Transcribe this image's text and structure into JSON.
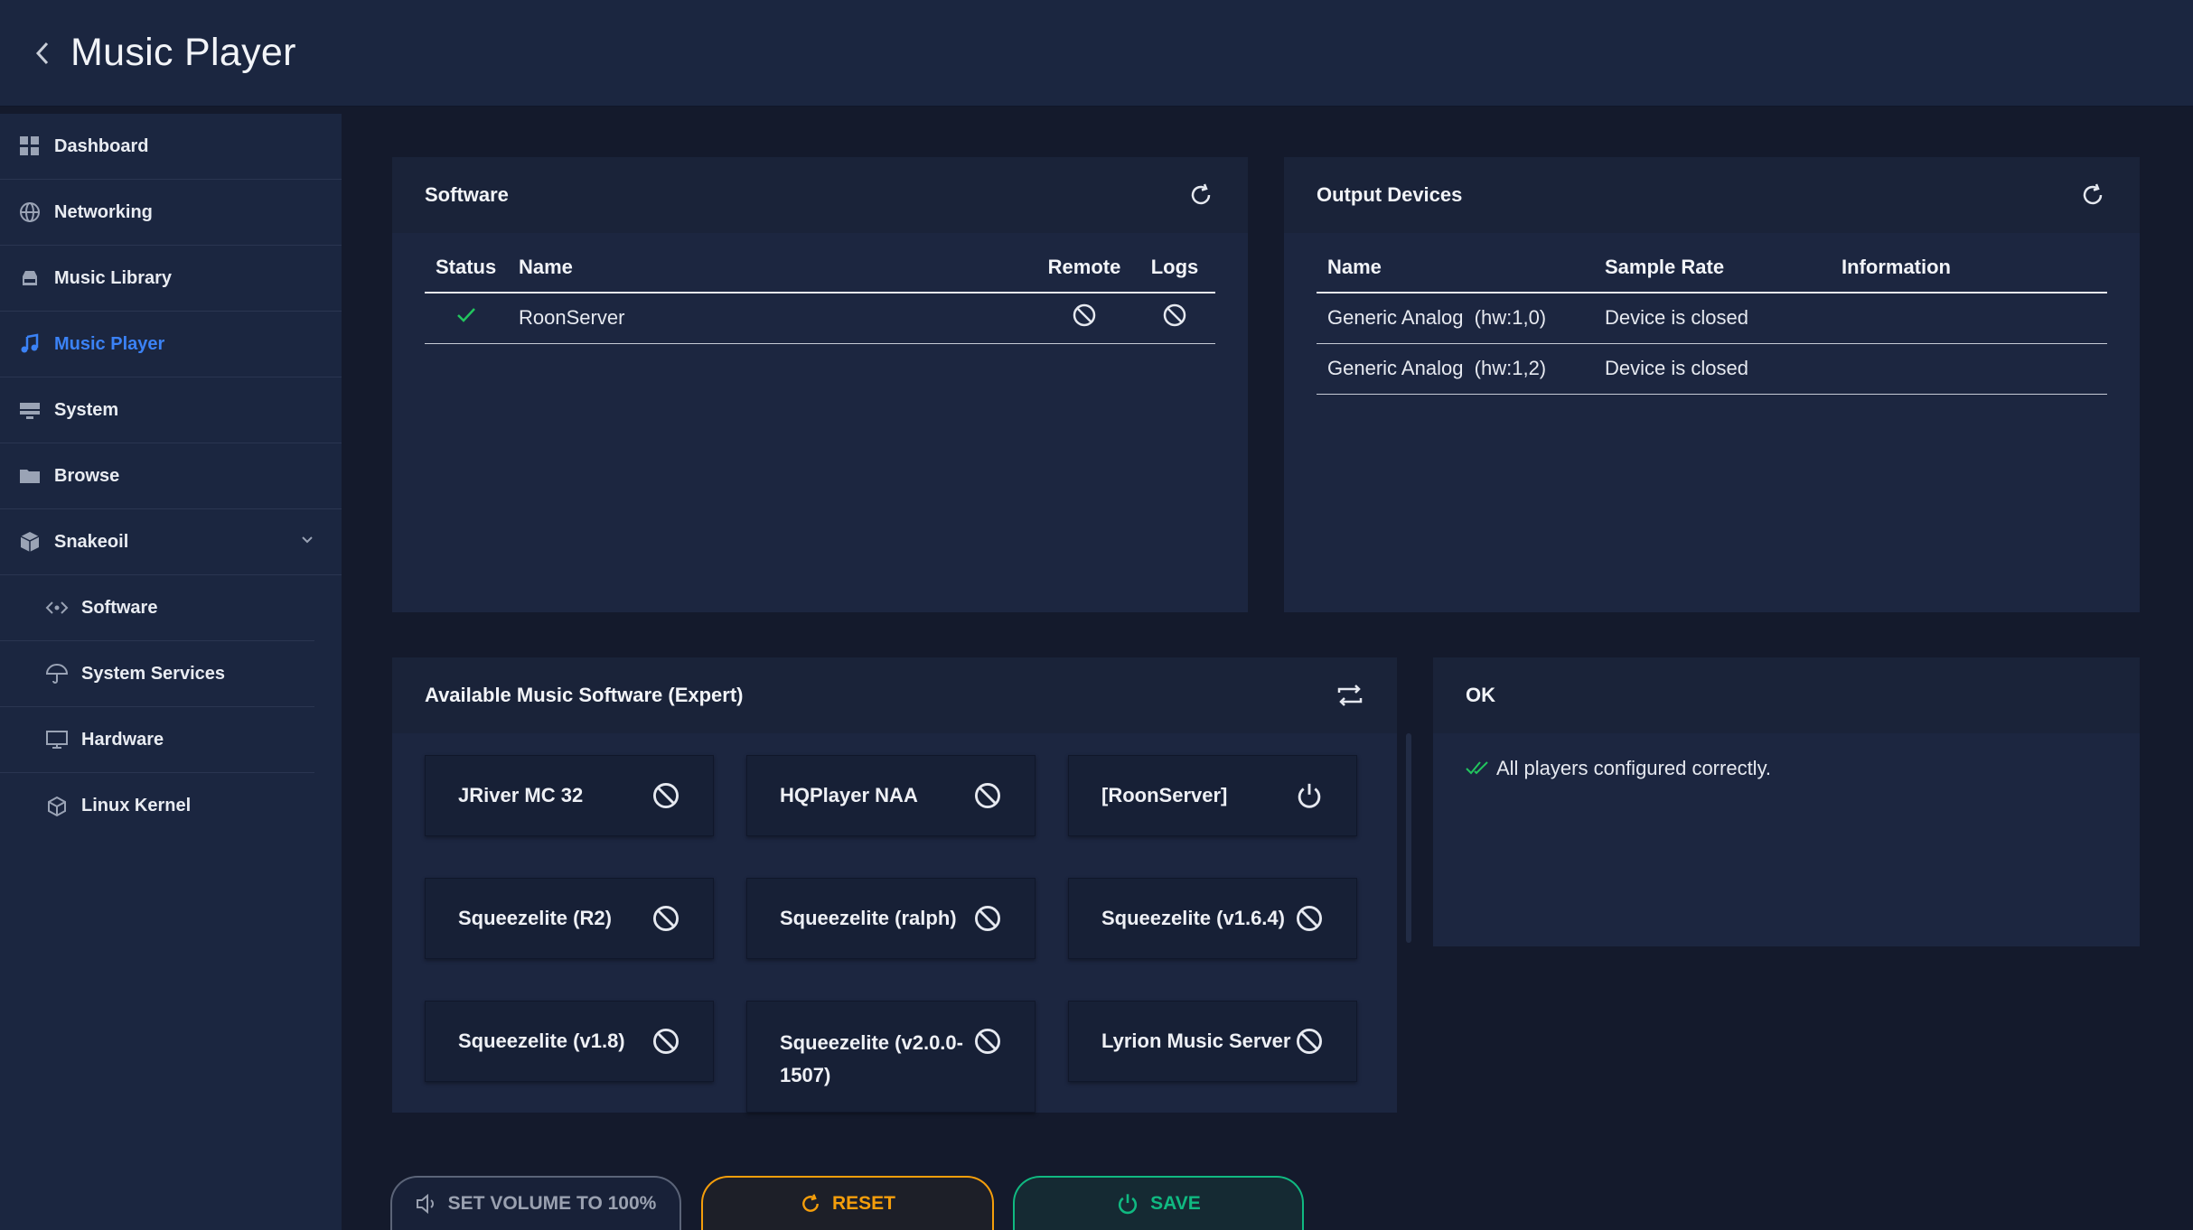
{
  "header": {
    "title": "Music Player"
  },
  "sidebar": {
    "items": [
      {
        "label": "Dashboard",
        "icon": "grid-icon"
      },
      {
        "label": "Networking",
        "icon": "globe-icon"
      },
      {
        "label": "Music Library",
        "icon": "drive-icon"
      },
      {
        "label": "Music Player",
        "icon": "music-note-icon",
        "active": true
      },
      {
        "label": "System",
        "icon": "server-icon"
      },
      {
        "label": "Browse",
        "icon": "folder-icon"
      },
      {
        "label": "Snakeoil",
        "icon": "cube-icon",
        "expanded": true
      }
    ],
    "subitems": [
      {
        "label": "Software",
        "icon": "code-icon"
      },
      {
        "label": "System Services",
        "icon": "umbrella-icon"
      },
      {
        "label": "Hardware",
        "icon": "monitor-icon"
      },
      {
        "label": "Linux Kernel",
        "icon": "box-icon"
      }
    ]
  },
  "software_card": {
    "title": "Software",
    "columns": [
      "Status",
      "Name",
      "Remote",
      "Logs"
    ],
    "rows": [
      {
        "status": "ok",
        "name": "RoonServer",
        "remote": "disabled",
        "logs": "disabled"
      }
    ]
  },
  "output_card": {
    "title": "Output Devices",
    "columns": [
      "Name",
      "Sample Rate",
      "Information"
    ],
    "rows": [
      {
        "name": "Generic Analog  (hw:1,0)",
        "sample_rate": "Device is closed",
        "information": ""
      },
      {
        "name": "Generic Analog  (hw:1,2)",
        "sample_rate": "Device is closed",
        "information": ""
      }
    ]
  },
  "available_card": {
    "title": "Available Music Software (Expert)",
    "items": [
      {
        "label": "JRiver MC 32",
        "state": "disabled"
      },
      {
        "label": "HQPlayer NAA",
        "state": "disabled"
      },
      {
        "label": "[RoonServer]",
        "state": "power"
      },
      {
        "label": "Squeezelite (R2)",
        "state": "disabled"
      },
      {
        "label": "Squeezelite (ralph)",
        "state": "disabled"
      },
      {
        "label": "Squeezelite (v1.6.4)",
        "state": "disabled"
      },
      {
        "label": "Squeezelite (v1.8)",
        "state": "disabled"
      },
      {
        "label": "Squeezelite (v2.0.0-1507)",
        "state": "disabled"
      },
      {
        "label": "Lyrion Music Server",
        "state": "disabled"
      }
    ]
  },
  "ok_card": {
    "title": "OK",
    "message": "All players configured correctly."
  },
  "actions": {
    "volume_label": "SET VOLUME TO 100%",
    "reset_label": "RESET",
    "save_label": "SAVE"
  },
  "colors": {
    "accent": "#3b82f6",
    "success": "#22c55e",
    "warning": "#f59e0b",
    "save": "#10b981"
  }
}
